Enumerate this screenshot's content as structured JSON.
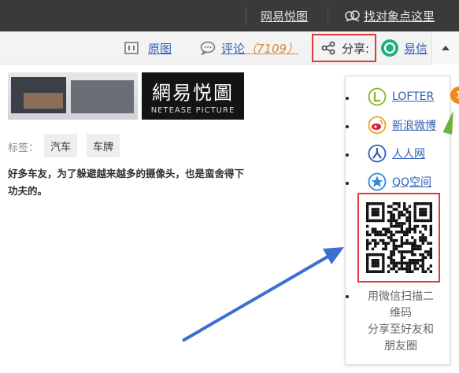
{
  "topbar": {
    "link1": "网易悦图",
    "link2": "找对象点这里"
  },
  "toolbar": {
    "original": "原图",
    "comment": "评论",
    "comment_count": "（7109）",
    "share": "分享:",
    "yixin": "易信"
  },
  "content": {
    "logo_cn": "網易悦圖",
    "logo_en": "NETEASE PICTURE",
    "tags_label": "标签：",
    "tags": [
      "汽车",
      "车牌"
    ],
    "description": "好多车友，为了躲避越来越多的摄像头，也是蛮舍得下功夫的。"
  },
  "share_panel": {
    "options": [
      {
        "label": "LOFTER",
        "icon": "lofter-icon",
        "color": "#8bb32a"
      },
      {
        "label": "新浪微博",
        "icon": "weibo-icon",
        "color": "#e6162d"
      },
      {
        "label": "人人网",
        "icon": "renren-icon",
        "color": "#2e5bb3"
      },
      {
        "label": "QQ空间",
        "icon": "qzone-icon",
        "color": "#2e8ad8"
      }
    ],
    "qr_text_1": "用微信扫描二",
    "qr_text_2": "维码",
    "qr_text_3": "分享至好友和",
    "qr_text_4": "朋友圈"
  },
  "badge": "1",
  "colors": {
    "topbar": "#3a3a3a",
    "highlight_border": "#e23a3a",
    "link": "#2f5fb3",
    "arrow": "#3b6fd1"
  }
}
